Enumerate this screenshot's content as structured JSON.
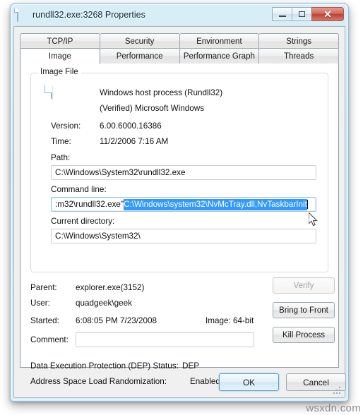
{
  "window": {
    "title": "rundll32.exe:3268 Properties",
    "icon": "document-icon",
    "caption_buttons": {
      "minimize": "minimize-icon",
      "maximize": "maximize-icon",
      "close": "✕"
    },
    "accent_close_color": "#bb4336",
    "frame_color": "#cde6f3"
  },
  "tabs": {
    "row1": [
      {
        "label": "TCP/IP",
        "selected": false
      },
      {
        "label": "Security",
        "selected": false
      },
      {
        "label": "Environment",
        "selected": false
      },
      {
        "label": "Strings",
        "selected": false
      }
    ],
    "row2": [
      {
        "label": "Image",
        "selected": true
      },
      {
        "label": "Performance",
        "selected": false
      },
      {
        "label": "Performance Graph",
        "selected": false
      },
      {
        "label": "Threads",
        "selected": false
      }
    ]
  },
  "image_tab": {
    "group_label": "Image File",
    "file_icon": "document-icon",
    "description": "Windows host process (Rundll32)",
    "publisher": "(Verified) Microsoft Windows",
    "version_label": "Version:",
    "version_value": "6.00.6000.16386",
    "time_label": "Time:",
    "time_value": "11/2/2006 7:16 AM",
    "path_label": "Path:",
    "path_value": "C:\\Windows\\System32\\rundll32.exe",
    "command_line_label": "Command line:",
    "command_line_prefix": ":m32\\rundll32.exe\"",
    "command_line_selected": "C:\\Windows\\system32\\NvMcTray.dll,NvTaskbarInit",
    "current_directory_label": "Current directory:",
    "current_directory_value": "C:\\Windows\\System32\\",
    "selection_color": "#3399ff"
  },
  "details": {
    "parent_label": "Parent:",
    "parent_value": "explorer.exe(3152)",
    "user_label": "User:",
    "user_value": "quadgeek\\geek",
    "started_label": "Started:",
    "started_value": "6:08:05 PM   7/23/2008",
    "image_bitness": "Image: 64-bit",
    "comment_label": "Comment:",
    "comment_value": "",
    "dep_label": "Data Execution Protection (DEP) Status:",
    "dep_value": "DEP",
    "aslr_label": "Address Space Load Randomization:",
    "aslr_value": "Enabled"
  },
  "side_buttons": {
    "verify": "Verify",
    "bring_to_front": "Bring to Front",
    "kill_process": "Kill Process"
  },
  "dialog_buttons": {
    "ok": "OK",
    "cancel": "Cancel"
  },
  "watermark": "wsxdn.com"
}
